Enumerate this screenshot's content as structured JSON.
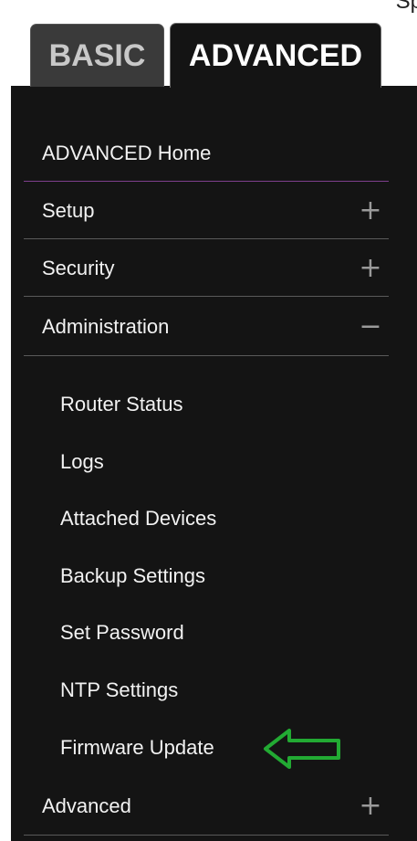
{
  "header": {
    "clipped_text": "Sp"
  },
  "tabs": {
    "basic": "BASIC",
    "advanced": "ADVANCED"
  },
  "menu": {
    "home": "ADVANCED Home",
    "items": [
      {
        "label": "Setup",
        "sign": "+"
      },
      {
        "label": "Security",
        "sign": "+"
      },
      {
        "label": "Administration",
        "sign": "−"
      },
      {
        "label": "Advanced",
        "sign": "+"
      }
    ],
    "admin_subitems": [
      "Router Status",
      "Logs",
      "Attached Devices",
      "Backup Settings",
      "Set Password",
      "NTP Settings",
      "Firmware Update"
    ]
  },
  "annotation": {
    "arrow_icon": "left-arrow-outline",
    "arrow_color": "#22aa33"
  },
  "colors": {
    "panel": "#141414",
    "active_divider": "#7d3f8c",
    "text": "#f2f2f2"
  }
}
